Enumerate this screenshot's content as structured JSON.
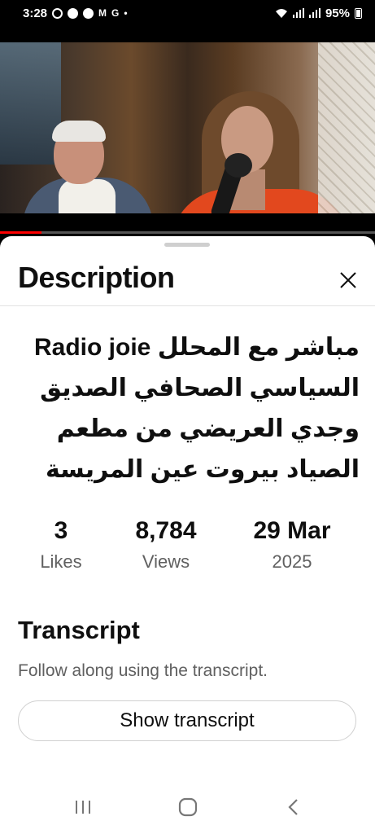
{
  "status_bar": {
    "time": "3:28",
    "notification_icons": [
      "whatsapp-icon",
      "messenger-icon",
      "messenger-icon",
      "gmail-icon",
      "google-icon"
    ],
    "notification_letters": [
      "M",
      "G"
    ],
    "dot": "•",
    "battery": "95%"
  },
  "video": {
    "progress_fraction": 0.11
  },
  "sheet": {
    "title": "Description",
    "description_title": "مباشر مع المحلل Radio joie السياسي الصحافي الصديق وجدي العريضي من مطعم الصياد بيروت عين المريسة",
    "stats": [
      {
        "value": "3",
        "label": "Likes"
      },
      {
        "value": "8,784",
        "label": "Views"
      },
      {
        "value": "29 Mar",
        "label": "2025"
      }
    ],
    "transcript": {
      "title": "Transcript",
      "subtitle": "Follow along using the transcript.",
      "button_label": "Show transcript"
    }
  },
  "colors": {
    "progress": "#ff0000",
    "text_primary": "#0f0f0f",
    "text_secondary": "#606060"
  }
}
